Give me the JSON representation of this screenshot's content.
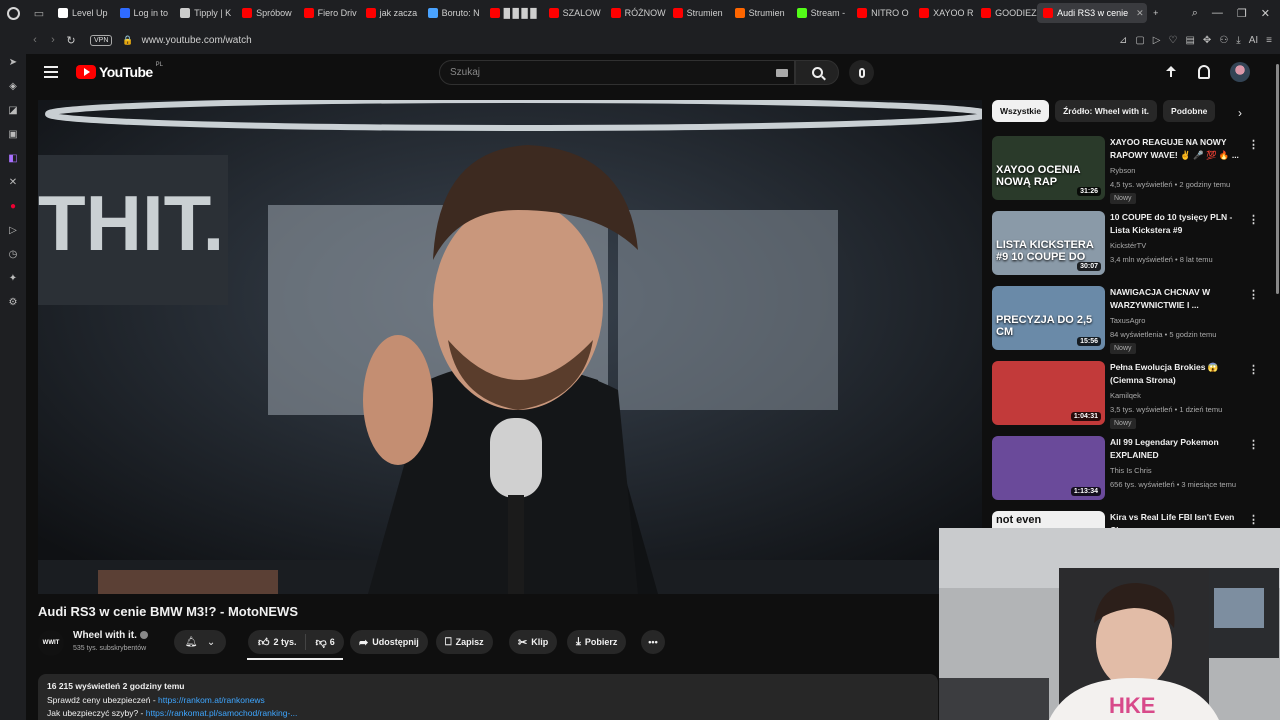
{
  "browser": {
    "tabs": [
      {
        "label": "Level Up",
        "color": "#ffffff"
      },
      {
        "label": "Log in to",
        "color": "#2f6bff"
      },
      {
        "label": "Tipply | K",
        "color": "#cccccc"
      },
      {
        "label": "Spróbow",
        "color": "#ff0000"
      },
      {
        "label": "Fiero Driv",
        "color": "#ff0000"
      },
      {
        "label": "jak zacza",
        "color": "#ff0000"
      },
      {
        "label": "Boruto: N",
        "color": "#4aa3ff"
      },
      {
        "label": "█ █ █ █",
        "color": "#ff0000"
      },
      {
        "label": "SZALOW",
        "color": "#ff0000"
      },
      {
        "label": "RÓŻNOW",
        "color": "#ff0000"
      },
      {
        "label": "Strumien",
        "color": "#ff0000"
      },
      {
        "label": "Strumien",
        "color": "#ff6600"
      },
      {
        "label": "Stream - ",
        "color": "#53fc18"
      },
      {
        "label": "NITRO O",
        "color": "#ff0000"
      },
      {
        "label": "XAYOO R",
        "color": "#ff0000"
      },
      {
        "label": "GOODIEZ",
        "color": "#ff0000"
      },
      {
        "label": "Audi RS3 w cenie",
        "color": "#ff0000",
        "active": true
      }
    ],
    "vpn_label": "VPN",
    "url": "www.youtube.com/watch",
    "ai_label": "AI"
  },
  "header": {
    "logo_text": "YouTube",
    "country": "PL",
    "search_placeholder": "Szukaj"
  },
  "video": {
    "title": "Audi RS3 w cenie BMW M3!? - MotoNEWS",
    "channel": "Wheel with it.",
    "channel_avatar_text": "WWIT",
    "subscribers": "535 tys. subskrybentów",
    "likes": "2 tys.",
    "dislikes": "6",
    "share": "Udostępnij",
    "save": "Zapisz",
    "clip": "Klip",
    "download": "Pobierz",
    "more": "•••"
  },
  "description": {
    "meta": "16 215 wyświetleń  2 godziny temu",
    "line1_text": "Sprawdź ceny ubezpieczeń - ",
    "line1_link": "https://rankom.at/rankonews",
    "line2_text": "Jak ubezpieczyć szyby? - ",
    "line2_link": "https://rankomat.pl/samochod/ranking-..."
  },
  "chips": [
    "Wszystkie",
    "Źródło: Wheel with it.",
    "Podobne"
  ],
  "recommendations": [
    {
      "title": "XAYOO REAGUJE NA NOWY RAPOWY WAVE! ✌️ 🎤 💯 🔥 ...",
      "channel": "Rybson",
      "meta": "4,5 tys. wyświetleń • 2 godziny temu",
      "badge": "Nowy",
      "duration": "31:26",
      "thumb_text": "XAYOO OCENIA NOWĄ RAP",
      "thumb_bg": "#2a3a2a"
    },
    {
      "title": "10 COUPE do 10 tysięcy PLN - Lista Kickstera #9",
      "channel": "KickstérTV",
      "meta": "3,4 mln wyświetleń • 8 lat temu",
      "badge": "",
      "duration": "30:07",
      "thumb_text": "LISTA KICKSTERA #9 10 COUPE DO",
      "thumb_bg": "#8a9aa8"
    },
    {
      "title": "NAWIGACJA CHCNAV W WARZYWNICTWIE I ...",
      "channel": "TaxusAgro",
      "meta": "84 wyświetlenia • 5 godzin temu",
      "badge": "Nowy",
      "duration": "15:56",
      "thumb_text": "PRECYZJA DO 2,5 CM",
      "thumb_bg": "#6a8aa8"
    },
    {
      "title": "Pełna Ewolucja Brokies 😱 (Ciemna Strona)",
      "channel": "Kamilqek",
      "meta": "3,5 tys. wyświetleń • 1 dzień temu",
      "badge": "Nowy",
      "duration": "1:04:31",
      "thumb_text": "",
      "thumb_bg": "#c23a3a"
    },
    {
      "title": "All 99 Legendary Pokemon EXPLAINED",
      "channel": "This Is Chris",
      "meta": "656 tys. wyświetleń • 3 miesiące temu",
      "badge": "",
      "duration": "1:13:34",
      "thumb_text": "",
      "thumb_bg": "#6a4a9a"
    },
    {
      "title": "Kira vs Real Life FBI Isn't Even Close",
      "channel": "",
      "meta": "",
      "badge": "",
      "duration": "",
      "thumb_text": "not even",
      "thumb_bg": "#f0f0f0"
    }
  ]
}
